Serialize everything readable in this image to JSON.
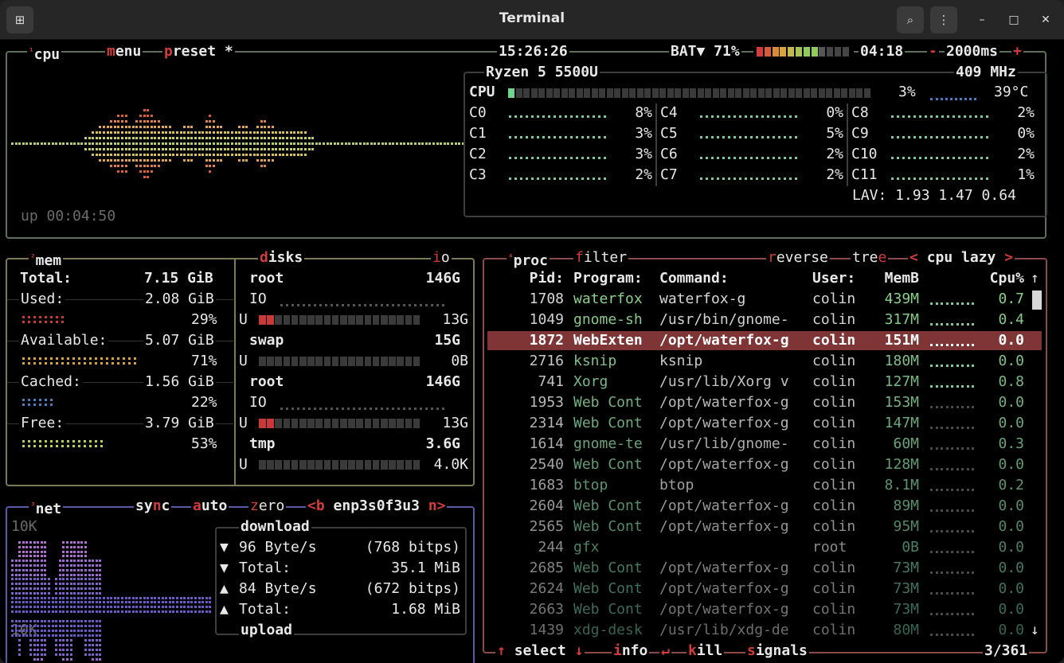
{
  "window": {
    "title": "Terminal"
  },
  "cpu_box": {
    "tab_num": "¹",
    "tab_cpu": "cpu",
    "menu_hot": "m",
    "menu_rest": "enu",
    "preset_hot": "p",
    "preset_rest": "reset",
    "preset_star": "*",
    "clock": "15:26:26",
    "bat_label": "BAT▼ 71%",
    "bat_pct": 0.71,
    "bat_time": "04:18",
    "rate_minus": "-",
    "rate": "2000ms",
    "rate_plus": "+",
    "uptime": "up 00:04:50",
    "model": "Ryzen 5 5500U",
    "freq": "409 MHz",
    "total_label": "CPU",
    "total_pct": "3%",
    "total_fill": 0.03,
    "temp": "39°C",
    "cores": [
      {
        "name": "C0",
        "pct": "8%"
      },
      {
        "name": "C1",
        "pct": "3%"
      },
      {
        "name": "C2",
        "pct": "3%"
      },
      {
        "name": "C3",
        "pct": "2%"
      },
      {
        "name": "C4",
        "pct": "0%"
      },
      {
        "name": "C5",
        "pct": "5%"
      },
      {
        "name": "C6",
        "pct": "2%"
      },
      {
        "name": "C7",
        "pct": "2%"
      },
      {
        "name": "C8",
        "pct": "2%"
      },
      {
        "name": "C9",
        "pct": "0%"
      },
      {
        "name": "C10",
        "pct": "2%"
      },
      {
        "name": "C11",
        "pct": "1%"
      }
    ],
    "lav": "LAV: 1.93 1.47 0.64"
  },
  "mem_box": {
    "tab_num": "²",
    "tab": "mem",
    "total_label": "Total:",
    "total_val": "7.15 GiB",
    "rows": [
      {
        "label": "Used:",
        "val": "2.08 GiB",
        "pct": "29%",
        "fill": 0.29,
        "color": "#c83a3a"
      },
      {
        "label": "Available:",
        "val": "5.07 GiB",
        "pct": "71%",
        "fill": 0.71,
        "color": "#d9a53b"
      },
      {
        "label": "Cached:",
        "val": "1.56 GiB",
        "pct": "22%",
        "fill": 0.22,
        "color": "#4a7dbd"
      },
      {
        "label": "Free:",
        "val": "3.79 GiB",
        "pct": "53%",
        "fill": 0.53,
        "color": "#b7cf52"
      }
    ]
  },
  "disks_box": {
    "tab_hot": "d",
    "tab_rest": "isks",
    "io_hot": "i",
    "io_rest": "o",
    "disks": [
      {
        "name": "root",
        "size": "146G",
        "line2": "IO",
        "used": "13G",
        "fill": 0.09
      },
      {
        "name": "swap",
        "size": "15G",
        "used": "0B",
        "fill": 0.0
      },
      {
        "name": "root",
        "size": "146G",
        "line2": "IO",
        "used": "13G",
        "fill": 0.09
      },
      {
        "name": "tmp",
        "size": "3.6G",
        "used": "4.0K",
        "fill": 0.0
      }
    ],
    "u_label": "U"
  },
  "net_box": {
    "tab_num": "³",
    "tab": "net",
    "sync_rest": "sy",
    "sync_hot": "n",
    "sync_end": "c",
    "auto_hot": "a",
    "auto_rest": "uto",
    "zero_hot": "z",
    "zero_rest": "ero",
    "b_lt": "<",
    "b_hot": "b",
    "iface": "enp3s0f3u3",
    "n_hot": "n",
    "n_gt": ">",
    "scale_top": "10K",
    "scale_bottom": "10K",
    "download": "download",
    "upload": "upload",
    "rows": [
      {
        "arrow": "▼",
        "text": "96 Byte/s",
        "extra": "(768 bitps)"
      },
      {
        "arrow": "▼",
        "text": "Total:",
        "extra": "35.1 MiB"
      },
      {
        "arrow": "▲",
        "text": "84 Byte/s",
        "extra": "(672 bitps)"
      },
      {
        "arrow": "▲",
        "text": "Total:",
        "extra": "1.68 MiB"
      }
    ]
  },
  "proc_box": {
    "tab_num": "⁴",
    "tab": "proc",
    "filter_hot": "f",
    "filter_rest": "ilter",
    "reverse_hot": "r",
    "reverse_rest": "everse",
    "tree_rest": "tre",
    "tree_hot": "e",
    "sort_lt": "<",
    "sort": "cpu lazy",
    "sort_gt": ">",
    "headers": {
      "pid": "Pid:",
      "program": "Program:",
      "command": "Command:",
      "user": "User:",
      "mem": "MemB",
      "cpu": "Cpu%"
    },
    "rows": [
      {
        "pid": "1708",
        "program": "waterfox",
        "command": "waterfox-g",
        "user": "colin",
        "mem": "439M",
        "cpu": "0.7"
      },
      {
        "pid": "1049",
        "program": "gnome-sh",
        "command": "/usr/bin/gnome-",
        "user": "colin",
        "mem": "317M",
        "cpu": "0.4"
      },
      {
        "pid": "1872",
        "program": "WebExten",
        "command": "/opt/waterfox-g",
        "user": "colin",
        "mem": "151M",
        "cpu": "0.0",
        "selected": true
      },
      {
        "pid": "2716",
        "program": "ksnip",
        "command": "ksnip",
        "user": "colin",
        "mem": "180M",
        "cpu": "0.0"
      },
      {
        "pid": "741",
        "program": "Xorg",
        "command": "/usr/lib/Xorg v",
        "user": "colin",
        "mem": "127M",
        "cpu": "0.8"
      },
      {
        "pid": "1953",
        "program": "Web Cont",
        "command": "/opt/waterfox-g",
        "user": "colin",
        "mem": "153M",
        "cpu": "0.0"
      },
      {
        "pid": "2314",
        "program": "Web Cont",
        "command": "/opt/waterfox-g",
        "user": "colin",
        "mem": "147M",
        "cpu": "0.0"
      },
      {
        "pid": "1614",
        "program": "gnome-te",
        "command": "/usr/lib/gnome-",
        "user": "colin",
        "mem": "60M",
        "cpu": "0.3"
      },
      {
        "pid": "2540",
        "program": "Web Cont",
        "command": "/opt/waterfox-g",
        "user": "colin",
        "mem": "128M",
        "cpu": "0.0"
      },
      {
        "pid": "1683",
        "program": "btop",
        "command": "btop",
        "user": "colin",
        "mem": "8.1M",
        "cpu": "0.2"
      },
      {
        "pid": "2604",
        "program": "Web Cont",
        "command": "/opt/waterfox-g",
        "user": "colin",
        "mem": "89M",
        "cpu": "0.0"
      },
      {
        "pid": "2565",
        "program": "Web Cont",
        "command": "/opt/waterfox-g",
        "user": "colin",
        "mem": "95M",
        "cpu": "0.0"
      },
      {
        "pid": "244",
        "program": "gfx",
        "command": "",
        "user": "root",
        "mem": "0B",
        "cpu": "0.0"
      },
      {
        "pid": "2685",
        "program": "Web Cont",
        "command": "/opt/waterfox-g",
        "user": "colin",
        "mem": "73M",
        "cpu": "0.0"
      },
      {
        "pid": "2624",
        "program": "Web Cont",
        "command": "/opt/waterfox-g",
        "user": "colin",
        "mem": "73M",
        "cpu": "0.0"
      },
      {
        "pid": "2663",
        "program": "Web Cont",
        "command": "/opt/waterfox-g",
        "user": "colin",
        "mem": "73M",
        "cpu": "0.0"
      },
      {
        "pid": "1439",
        "program": "xdg-desk",
        "command": "/usr/lib/xdg-de",
        "user": "colin",
        "mem": "80M",
        "cpu": "0.0"
      }
    ],
    "footer": {
      "up_arrow": "↑",
      "select": "select",
      "down_arrow": "↓",
      "info_hot": "i",
      "info_rest": "nfo",
      "enter": "↵",
      "kill_k": "k",
      "kill_rest": "ill",
      "signals_hot": "s",
      "signals_rest": "ignals",
      "count": "3/361"
    },
    "scroll_up": "↑",
    "scroll_down": "↓"
  },
  "colors": {
    "cpu_border": "#5e6f5e",
    "mem_border": "#7a7a56",
    "net_border": "#5b59a8",
    "proc_border": "#8a4a4a",
    "accent": "#d33c3c",
    "selected_row": "#7f3535",
    "program_green": "#8bd08b"
  },
  "icons": [
    "new-tab-icon",
    "search-icon",
    "kebab-menu-icon",
    "minimize-icon",
    "maximize-icon",
    "close-icon"
  ]
}
